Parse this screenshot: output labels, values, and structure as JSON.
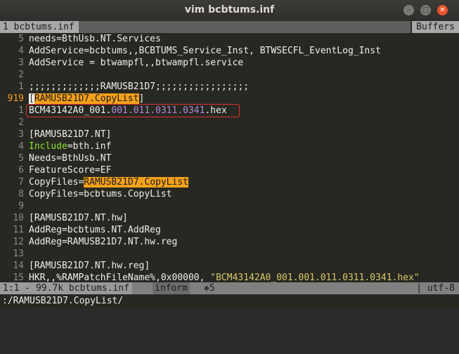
{
  "window": {
    "title": "vim bcbtums.inf"
  },
  "tabline": {
    "active_tab": "1 bcbtums.inf",
    "buffers_label": "Buffers"
  },
  "editor": {
    "lines": [
      {
        "num": "5",
        "text": "needs=BthUsb.NT.Services"
      },
      {
        "num": "4",
        "text": "AddService=bcbtums,,BCBTUMS_Service_Inst, BTWSECFL_EventLog_Inst"
      },
      {
        "num": "3",
        "text": "AddService = btwampfl,,btwampfl.service"
      },
      {
        "num": "2",
        "text": ""
      },
      {
        "num": "1",
        "text": ";;;;;;;;;;;;;RAMUSB21D7;;;;;;;;;;;;;;;;;"
      },
      {
        "num": "919",
        "bracket": "[",
        "highlight": "RAMUSB21D7.CopyList",
        "close": "]"
      },
      {
        "num": "1",
        "prefix": "BCM43142A0_001.",
        "version": "001.011.0311.0341",
        "suffix": ".hex"
      },
      {
        "num": "2",
        "text": ""
      },
      {
        "num": "3",
        "text": "[RAMUSB21D7.NT]"
      },
      {
        "num": "4",
        "keyword": "Include",
        "rest": "=bth.inf"
      },
      {
        "num": "5",
        "text": "Needs=BthUsb.NT"
      },
      {
        "num": "6",
        "text": "FeatureScore=EF"
      },
      {
        "num": "7",
        "prefix": "CopyFiles=",
        "highlight": "RAMUSB21D7.CopyList"
      },
      {
        "num": "8",
        "text": "CopyFiles=bcbtums.CopyList"
      },
      {
        "num": "9",
        "text": ""
      },
      {
        "num": "10",
        "text": "[RAMUSB21D7.NT.hw]"
      },
      {
        "num": "11",
        "text": "AddReg=bcbtums.NT.AddReg"
      },
      {
        "num": "12",
        "text": "AddReg=RAMUSB21D7.NT.hw.reg"
      },
      {
        "num": "13",
        "text": ""
      },
      {
        "num": "14",
        "text": "[RAMUSB21D7.NT.hw.reg]"
      },
      {
        "num": "15",
        "prefix": "HKR,,%RAMPatchFileName%,0x00000, ",
        "string": "\"BCM43142A0_001.001.011.0311.0341.hex\""
      }
    ]
  },
  "statusline": {
    "left": "1:1 - 99.7k bcbtums.inf",
    "info": "inform",
    "icon": "❖5",
    "right": "| utf-8"
  },
  "cmdline": {
    "text": ":/RAMUSB21D7.CopyList/"
  },
  "colors": {
    "accent": "#f4a11a",
    "highlight_box": "#e03030",
    "keyword": "#8ae234",
    "version": "#b08ad8",
    "string": "#d8c86a"
  }
}
